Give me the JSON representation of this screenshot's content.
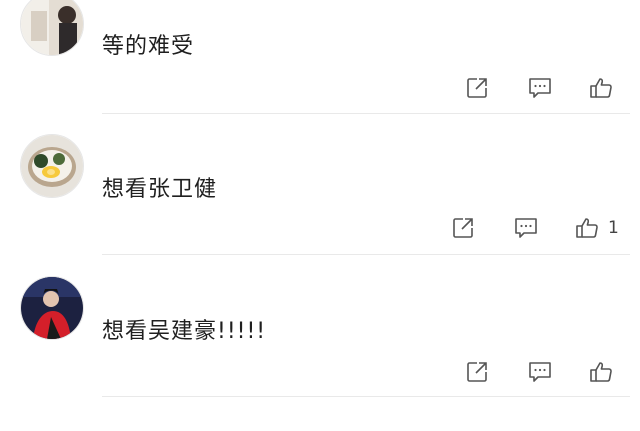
{
  "comments": [
    {
      "text": "等的难受",
      "avatar": "avatar-woman-white-background",
      "like_count": ""
    },
    {
      "text": "想看张卫健",
      "avatar": "avatar-food-bowl",
      "like_count": "1"
    },
    {
      "text": "想看吴建豪!!!!!",
      "avatar": "avatar-person-red-dark-stage",
      "like_count": ""
    }
  ],
  "icons": {
    "share": "share-icon",
    "comment": "comment-icon",
    "like": "thumbs-up-icon"
  },
  "colors": {
    "icon": "#555555",
    "text": "#1f1f1f",
    "divider": "#e9e9e9"
  }
}
